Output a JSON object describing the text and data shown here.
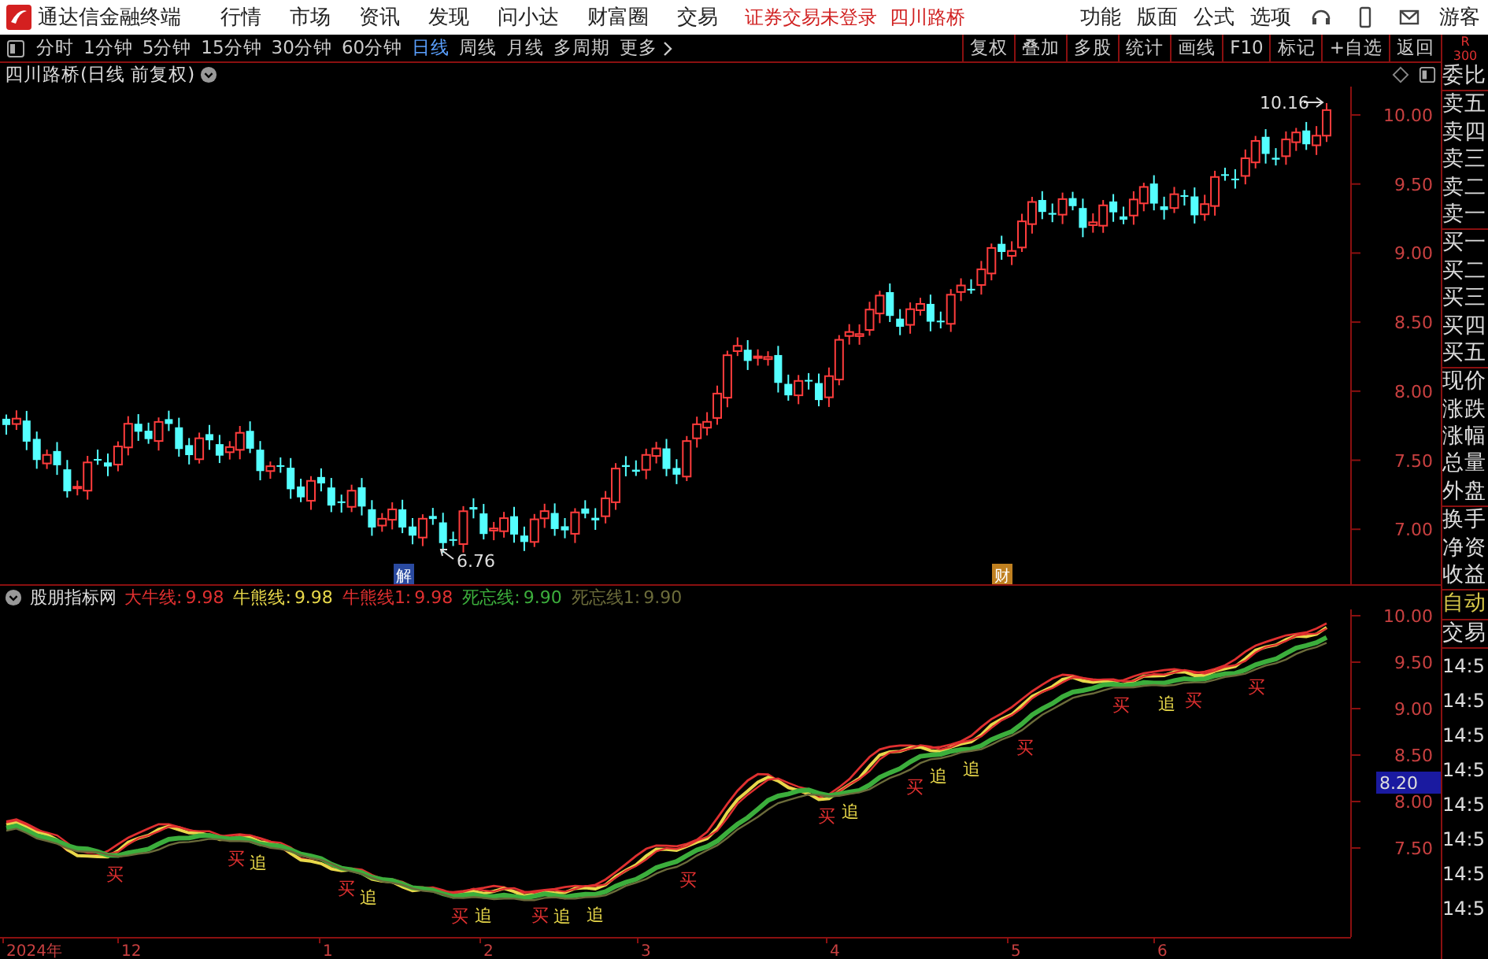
{
  "top_bar": {
    "app_title": "通达信金融终端",
    "menus": [
      "行情",
      "市场",
      "资讯",
      "发现",
      "问小达",
      "财富圈",
      "交易"
    ],
    "login_status": "证券交易未登录",
    "stock_name": "四川路桥",
    "right_menus": [
      "功能",
      "版面",
      "公式",
      "选项"
    ],
    "user": "游客"
  },
  "toolbar": {
    "periods": [
      {
        "label": "分时",
        "selected": false
      },
      {
        "label": "1分钟",
        "selected": false
      },
      {
        "label": "5分钟",
        "selected": false
      },
      {
        "label": "15分钟",
        "selected": false
      },
      {
        "label": "30分钟",
        "selected": false
      },
      {
        "label": "60分钟",
        "selected": false
      },
      {
        "label": "日线",
        "selected": true
      },
      {
        "label": "周线",
        "selected": false
      },
      {
        "label": "月线",
        "selected": false
      },
      {
        "label": "多周期",
        "selected": false
      }
    ],
    "more": "更多",
    "buttons": [
      "复权",
      "叠加",
      "多股",
      "统计",
      "画线",
      "F10",
      "标记",
      "+自选",
      "返回"
    ]
  },
  "chart": {
    "title": "四川路桥(日线 前复权)",
    "price_axis": [
      "10.00",
      "9.50",
      "9.00",
      "8.50",
      "8.00",
      "7.50",
      "7.00"
    ],
    "high_label": "10.16",
    "low_label": "6.76",
    "markers": [
      {
        "kind": "unlock",
        "text": "解"
      },
      {
        "kind": "finance",
        "text": "财"
      }
    ]
  },
  "indicator": {
    "name": "股朋指标网",
    "legend": [
      {
        "label": "大牛线:",
        "value": "9.98",
        "color": "#e03030"
      },
      {
        "label": "牛熊线:",
        "value": "9.98",
        "color": "#e8d84a"
      },
      {
        "label": "牛熊线1:",
        "value": "9.98",
        "color": "#e03030"
      },
      {
        "label": "死忘线:",
        "value": "9.90",
        "color": "#3cae3c"
      },
      {
        "label": "死忘线1:",
        "value": "9.90",
        "color": "#6b6b3a"
      }
    ],
    "axis": [
      "10.00",
      "9.50",
      "9.00",
      "8.50",
      "8.00",
      "7.50"
    ],
    "cursor_value": "8.20",
    "signals": [
      {
        "kind": "buy",
        "text": "买"
      },
      {
        "kind": "buy",
        "text": "买"
      },
      {
        "kind": "chase",
        "text": "追"
      },
      {
        "kind": "buy",
        "text": "买"
      },
      {
        "kind": "chase",
        "text": "追"
      },
      {
        "kind": "buy",
        "text": "买"
      },
      {
        "kind": "chase",
        "text": "追"
      },
      {
        "kind": "buy",
        "text": "买"
      },
      {
        "kind": "chase",
        "text": "追"
      },
      {
        "kind": "chase",
        "text": "追"
      },
      {
        "kind": "buy",
        "text": "买"
      },
      {
        "kind": "buy",
        "text": "买"
      },
      {
        "kind": "chase",
        "text": "追"
      },
      {
        "kind": "buy",
        "text": "买"
      },
      {
        "kind": "chase",
        "text": "追"
      },
      {
        "kind": "chase",
        "text": "追"
      },
      {
        "kind": "buy",
        "text": "买"
      },
      {
        "kind": "buy",
        "text": "买"
      },
      {
        "kind": "chase",
        "text": "追"
      },
      {
        "kind": "buy",
        "text": "买"
      },
      {
        "kind": "buy",
        "text": "买"
      }
    ]
  },
  "time_axis": [
    "2024年",
    "12",
    "1",
    "2",
    "3",
    "4",
    "5",
    "6"
  ],
  "side_panel": {
    "header": [
      "R",
      "300"
    ],
    "quote_groups": [
      [
        "委比"
      ],
      [
        "卖五",
        "卖四",
        "卖三",
        "卖二",
        "卖一"
      ],
      [
        "买一",
        "买二",
        "买三",
        "买四",
        "买五"
      ],
      [
        "现价",
        "涨跌",
        "涨幅",
        "总量",
        "外盘"
      ],
      [
        "换手",
        "净资",
        "收益"
      ]
    ],
    "trade_tabs": [
      "自动",
      "交易"
    ],
    "trade_times": [
      "14:5",
      "14:5",
      "14:5",
      "14:5",
      "14:5",
      "14:5",
      "14:5",
      "14:5"
    ]
  }
}
